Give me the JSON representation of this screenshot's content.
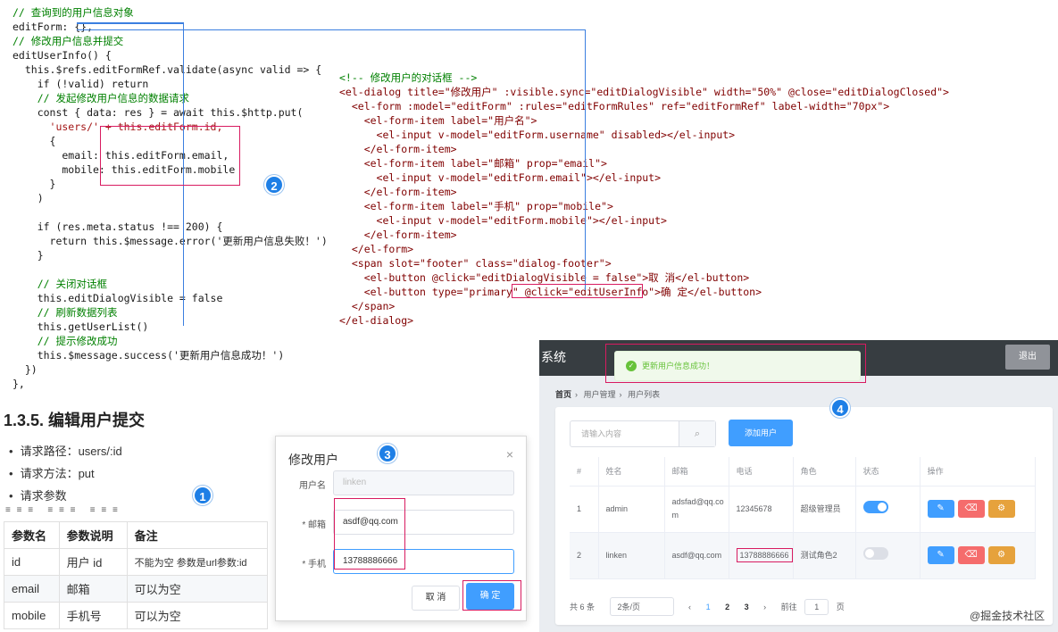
{
  "js_code": {
    "lines": [
      {
        "cls": "cmt",
        "text": "// 查询到的用户信息对象"
      },
      {
        "cls": "",
        "text": "editForm: {},"
      },
      {
        "cls": "cmt",
        "text": "// 修改用户信息并提交"
      },
      {
        "cls": "",
        "text": "editUserInfo() {"
      },
      {
        "cls": "",
        "text": "  this.$refs.editFormRef.validate(async valid => {"
      },
      {
        "cls": "",
        "text": "    if (!valid) return"
      },
      {
        "cls": "cmt",
        "text": "    // 发起修改用户信息的数据请求"
      },
      {
        "cls": "",
        "text": "    const { data: res } = await this.$http.put("
      },
      {
        "cls": "str",
        "text": "      'users/' + this.editForm.id,"
      },
      {
        "cls": "",
        "text": "      {"
      },
      {
        "cls": "",
        "text": "        email: this.editForm.email,"
      },
      {
        "cls": "",
        "text": "        mobile: this.editForm.mobile"
      },
      {
        "cls": "",
        "text": "      }"
      },
      {
        "cls": "",
        "text": "    )"
      },
      {
        "cls": "",
        "text": ""
      },
      {
        "cls": "",
        "text": "    if (res.meta.status !== 200) {"
      },
      {
        "cls": "",
        "text": "      return this.$message.error('更新用户信息失败！')"
      },
      {
        "cls": "",
        "text": "    }"
      },
      {
        "cls": "",
        "text": ""
      },
      {
        "cls": "cmt",
        "text": "    // 关闭对话框"
      },
      {
        "cls": "",
        "text": "    this.editDialogVisible = false"
      },
      {
        "cls": "cmt",
        "text": "    // 刷新数据列表"
      },
      {
        "cls": "",
        "text": "    this.getUserList()"
      },
      {
        "cls": "cmt",
        "text": "    // 提示修改成功"
      },
      {
        "cls": "",
        "text": "    this.$message.success('更新用户信息成功！')"
      },
      {
        "cls": "",
        "text": "  })"
      },
      {
        "cls": "",
        "text": "},"
      }
    ]
  },
  "html_code": {
    "lines": [
      {
        "cls": "cmt",
        "text": "<!-- 修改用户的对话框 -->"
      },
      {
        "cls": "tag",
        "text": "<el-dialog title=\"修改用户\" :visible.sync=\"editDialogVisible\" width=\"50%\" @close=\"editDialogClosed\">"
      },
      {
        "cls": "tag",
        "text": "  <el-form :model=\"editForm\" :rules=\"editFormRules\" ref=\"editFormRef\" label-width=\"70px\">"
      },
      {
        "cls": "tag",
        "text": "    <el-form-item label=\"用户名\">"
      },
      {
        "cls": "tag",
        "text": "      <el-input v-model=\"editForm.username\" disabled></el-input>"
      },
      {
        "cls": "tag",
        "text": "    </el-form-item>"
      },
      {
        "cls": "tag",
        "text": "    <el-form-item label=\"邮箱\" prop=\"email\">"
      },
      {
        "cls": "tag",
        "text": "      <el-input v-model=\"editForm.email\"></el-input>"
      },
      {
        "cls": "tag",
        "text": "    </el-form-item>"
      },
      {
        "cls": "tag",
        "text": "    <el-form-item label=\"手机\" prop=\"mobile\">"
      },
      {
        "cls": "tag",
        "text": "      <el-input v-model=\"editForm.mobile\"></el-input>"
      },
      {
        "cls": "tag",
        "text": "    </el-form-item>"
      },
      {
        "cls": "tag",
        "text": "  </el-form>"
      },
      {
        "cls": "tag",
        "text": "  <span slot=\"footer\" class=\"dialog-footer\">"
      },
      {
        "cls": "tag",
        "text": "    <el-button @click=\"editDialogVisible = false\">取 消</el-button>"
      },
      {
        "cls": "tag",
        "text": "    <el-button type=\"primary\" @click=\"editUserInfo\">确 定</el-button>"
      },
      {
        "cls": "tag",
        "text": "  </span>"
      },
      {
        "cls": "tag",
        "text": "</el-dialog>"
      }
    ]
  },
  "badges": [
    "1",
    "2",
    "3",
    "4"
  ],
  "doc": {
    "title": "1.3.5. 编辑用户提交",
    "bullets": [
      "请求路径：users/:id",
      "请求方法：put",
      "请求参数"
    ],
    "table_headers": [
      "参数名",
      "参数说明",
      "备注"
    ],
    "table_rows": [
      [
        "id",
        "用户 id",
        "不能为空 参数是url参数:id"
      ],
      [
        "email",
        "邮箱",
        "可以为空"
      ],
      [
        "mobile",
        "手机号",
        "可以为空"
      ]
    ]
  },
  "dialog": {
    "title": "修改用户",
    "close": "×",
    "username_label": "用户名",
    "username_value": "linken",
    "email_label": "* 邮箱",
    "email_value": "asdf@qq.com",
    "mobile_label": "* 手机",
    "mobile_value": "13788886666",
    "cancel": "取 消",
    "ok": "确 定"
  },
  "app": {
    "title": "系统",
    "logout": "退出",
    "toast": "更新用户信息成功！",
    "breadcrumb": [
      "首页",
      "用户管理",
      "用户列表"
    ],
    "search_placeholder": "请输入内容",
    "add_button": "添加用户",
    "columns": [
      "#",
      "姓名",
      "邮箱",
      "电话",
      "角色",
      "状态",
      "操作"
    ],
    "rows": [
      {
        "idx": "1",
        "name": "admin",
        "email": "adsfad@qq.com",
        "phone": "12345678",
        "role": "超级管理员",
        "status": true
      },
      {
        "idx": "2",
        "name": "linken",
        "email": "asdf@qq.com",
        "phone": "13788886666",
        "role": "测试角色2",
        "status": false
      }
    ],
    "pager": {
      "total": "共 6 条",
      "size": "2条/页",
      "pages": [
        "1",
        "2",
        "3"
      ],
      "goto": "前往",
      "goto_value": "1",
      "page_unit": "页"
    }
  },
  "watermark": "@掘金技术社区",
  "colors": {
    "accent": "#409eff",
    "highlight_box": "#d81b60",
    "badge": "#1e7fe6",
    "success": "#67c23a"
  }
}
